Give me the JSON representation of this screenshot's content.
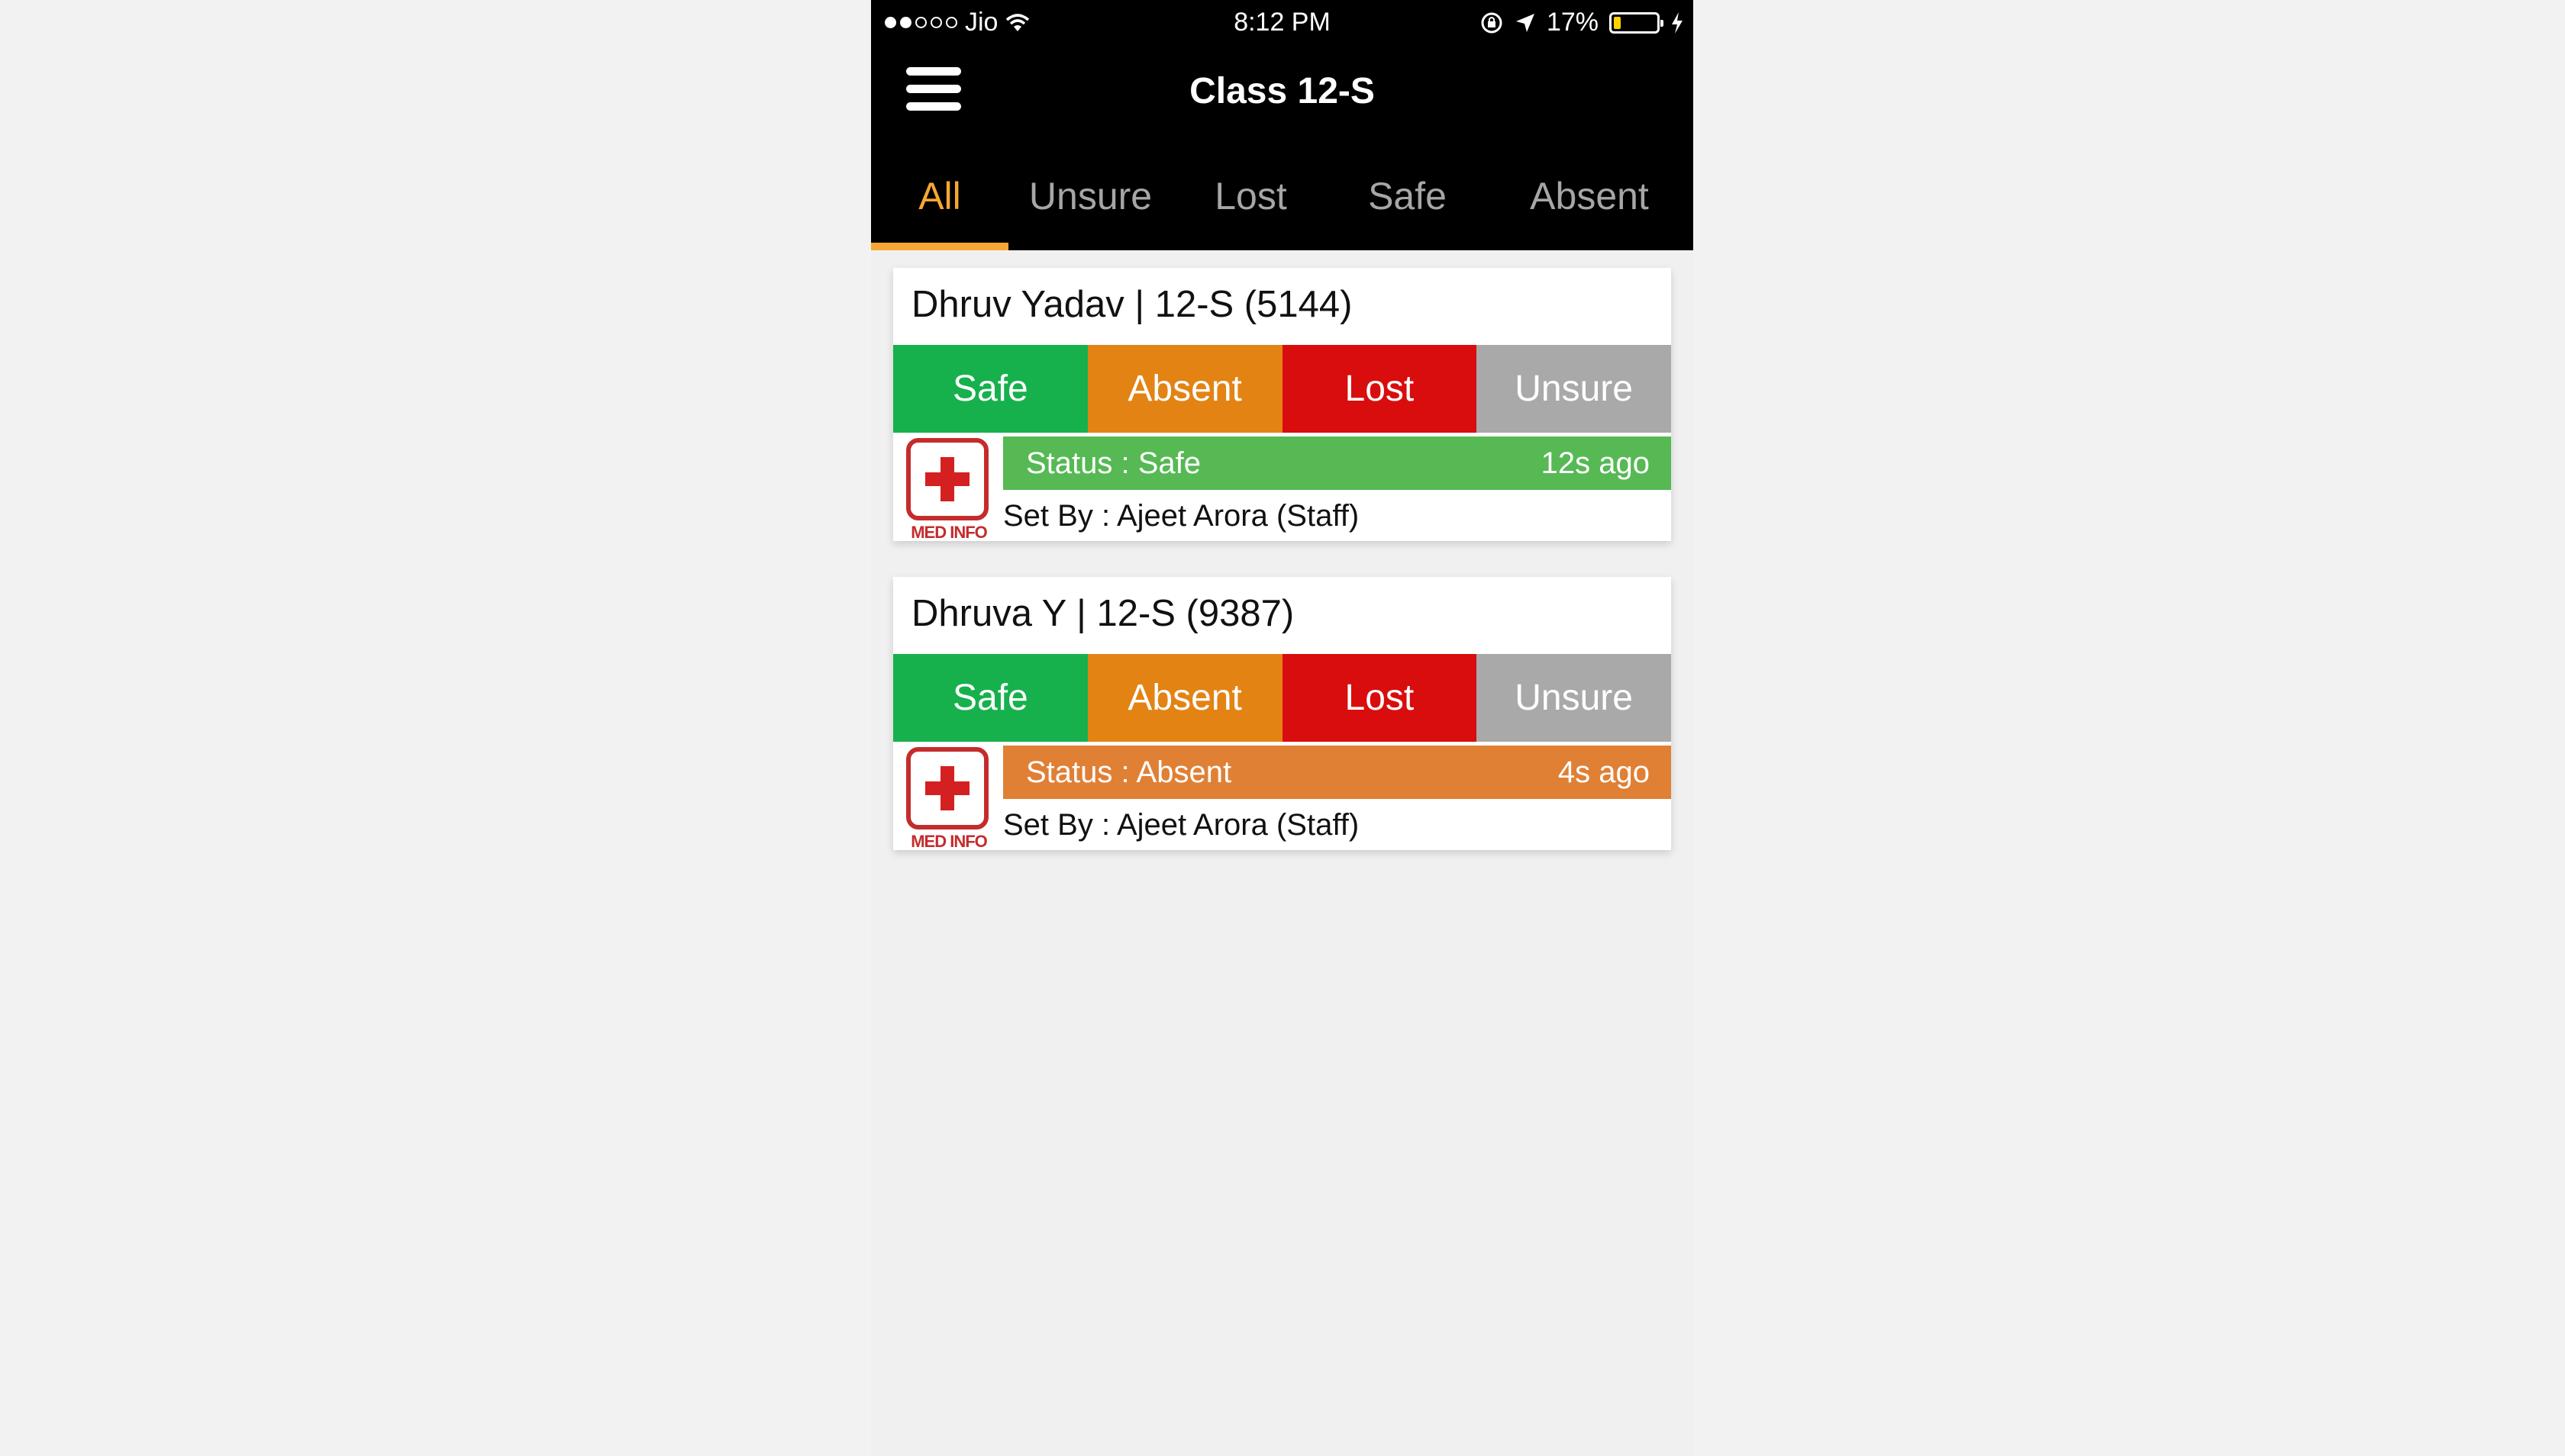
{
  "status_bar": {
    "carrier": "Jio",
    "time": "8:12 PM",
    "battery": "17%",
    "battery_level": 0.17
  },
  "nav": {
    "title": "Class 12-S",
    "menu_icon": "hamburger-menu-icon"
  },
  "tabs": [
    {
      "label": "All",
      "active": true
    },
    {
      "label": "Unsure",
      "active": false
    },
    {
      "label": "Lost",
      "active": false
    },
    {
      "label": "Safe",
      "active": false
    },
    {
      "label": "Absent",
      "active": false
    }
  ],
  "colors": {
    "accent": "#f7a733",
    "safe": "#16b14c",
    "absent": "#e38314",
    "lost": "#d90d0d",
    "unsure": "#a9a9a9",
    "status_safe": "#56b954",
    "status_absent": "#e08035"
  },
  "students": [
    {
      "name": "Dhruv Yadav | 12-S (5144)",
      "actions": {
        "safe": "Safe",
        "absent": "Absent",
        "lost": "Lost",
        "unsure": "Unsure"
      },
      "med_label": "MED INFO",
      "status": "Status : Safe",
      "time_ago": "12s ago",
      "set_by": "Set By : Ajeet Arora (Staff)"
    },
    {
      "name": "Dhruva Y | 12-S (9387)",
      "actions": {
        "safe": "Safe",
        "absent": "Absent",
        "lost": "Lost",
        "unsure": "Unsure"
      },
      "med_label": "MED INFO",
      "status": "Status : Absent",
      "time_ago": "4s ago",
      "set_by": "Set By : Ajeet Arora (Staff)"
    }
  ]
}
